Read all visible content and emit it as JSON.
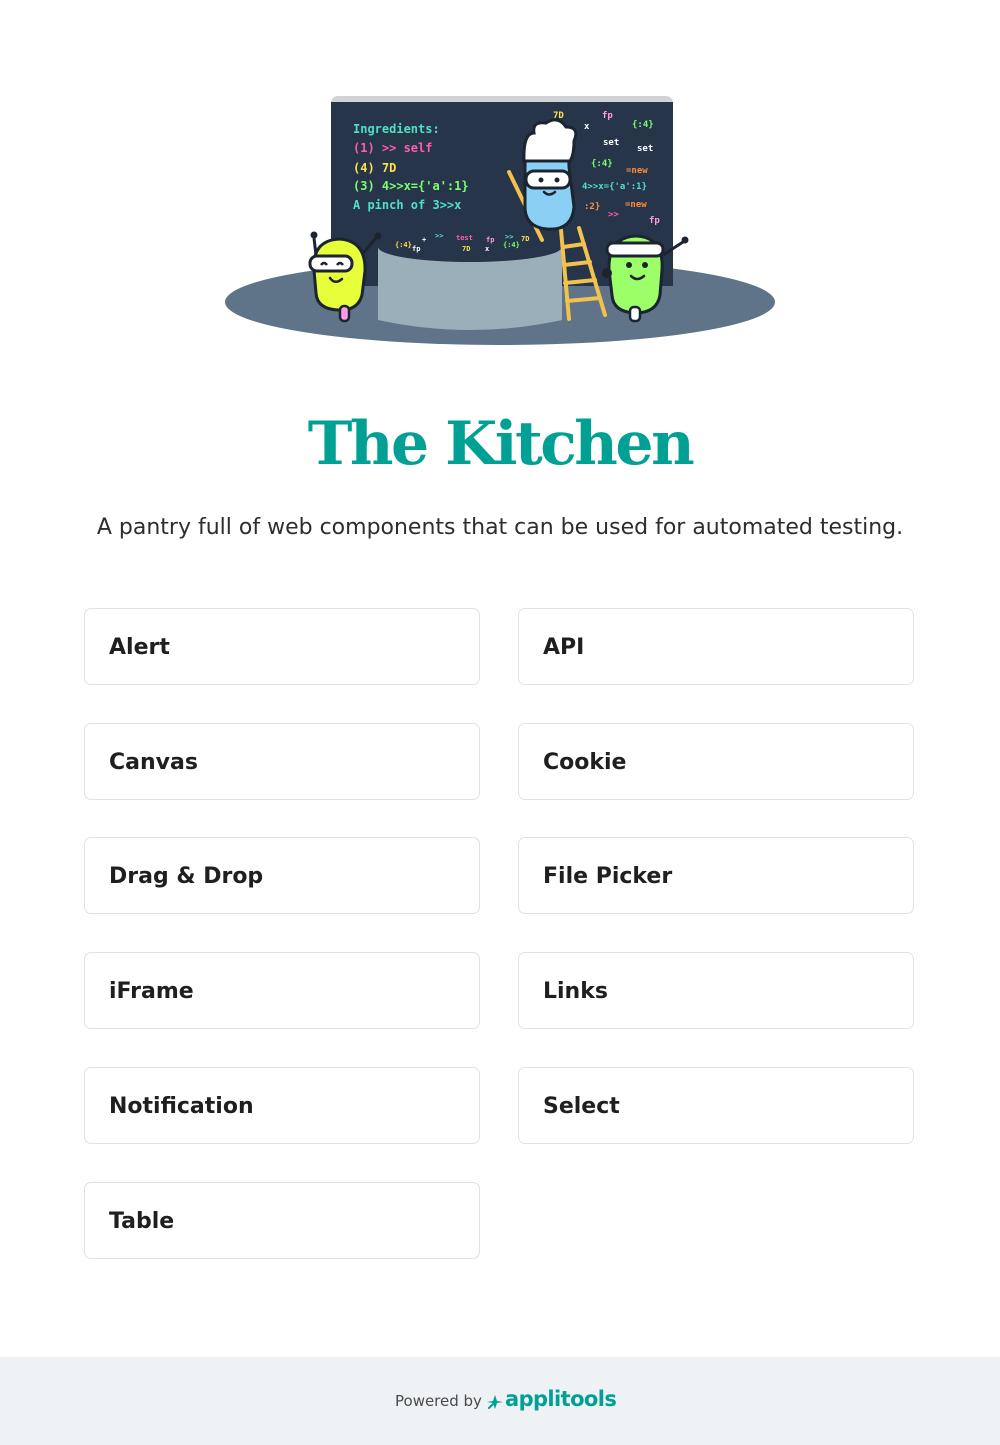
{
  "header": {
    "title": "The Kitchen",
    "subtitle": "A pantry full of web components that can be used for automated testing."
  },
  "illustration": {
    "recipe_lines": [
      "Ingredients:",
      "(1) >> self",
      "(4) 7D",
      "(3) 4>>x={'a':1}",
      "A pinch of 3>>x"
    ],
    "scattered_tokens": [
      "7D",
      "x",
      "fp",
      "{:4}",
      "set",
      "set",
      "{:4}",
      "=new",
      "4>>x={'a':1}",
      ":2}",
      "=new",
      ">>",
      "fp"
    ],
    "pot_tokens": [
      "{:4}",
      "+",
      ">>",
      "test",
      "fp",
      ">>",
      "7D",
      "fp",
      "7D",
      "x",
      "{:4}"
    ],
    "colors": {
      "board": "#263549",
      "pot": "#9aafba",
      "shadow": "#5f7489",
      "robot_yellow": "#e6ff3a",
      "robot_green": "#9cff6a",
      "robot_blue": "#8ad0f5",
      "ladder": "#f2c14e"
    }
  },
  "components": [
    {
      "label": "Alert"
    },
    {
      "label": "API"
    },
    {
      "label": "Canvas"
    },
    {
      "label": "Cookie"
    },
    {
      "label": "Drag & Drop"
    },
    {
      "label": "File Picker"
    },
    {
      "label": "iFrame"
    },
    {
      "label": "Links"
    },
    {
      "label": "Notification"
    },
    {
      "label": "Select"
    },
    {
      "label": "Table"
    }
  ],
  "footer": {
    "powered_by": "Powered by",
    "brand": "applitools",
    "brand_icon": "applitools-logo-icon"
  },
  "theme": {
    "accent": "#00a094",
    "card_border": "#dfe2e6",
    "footer_bg": "#eef2f5"
  }
}
